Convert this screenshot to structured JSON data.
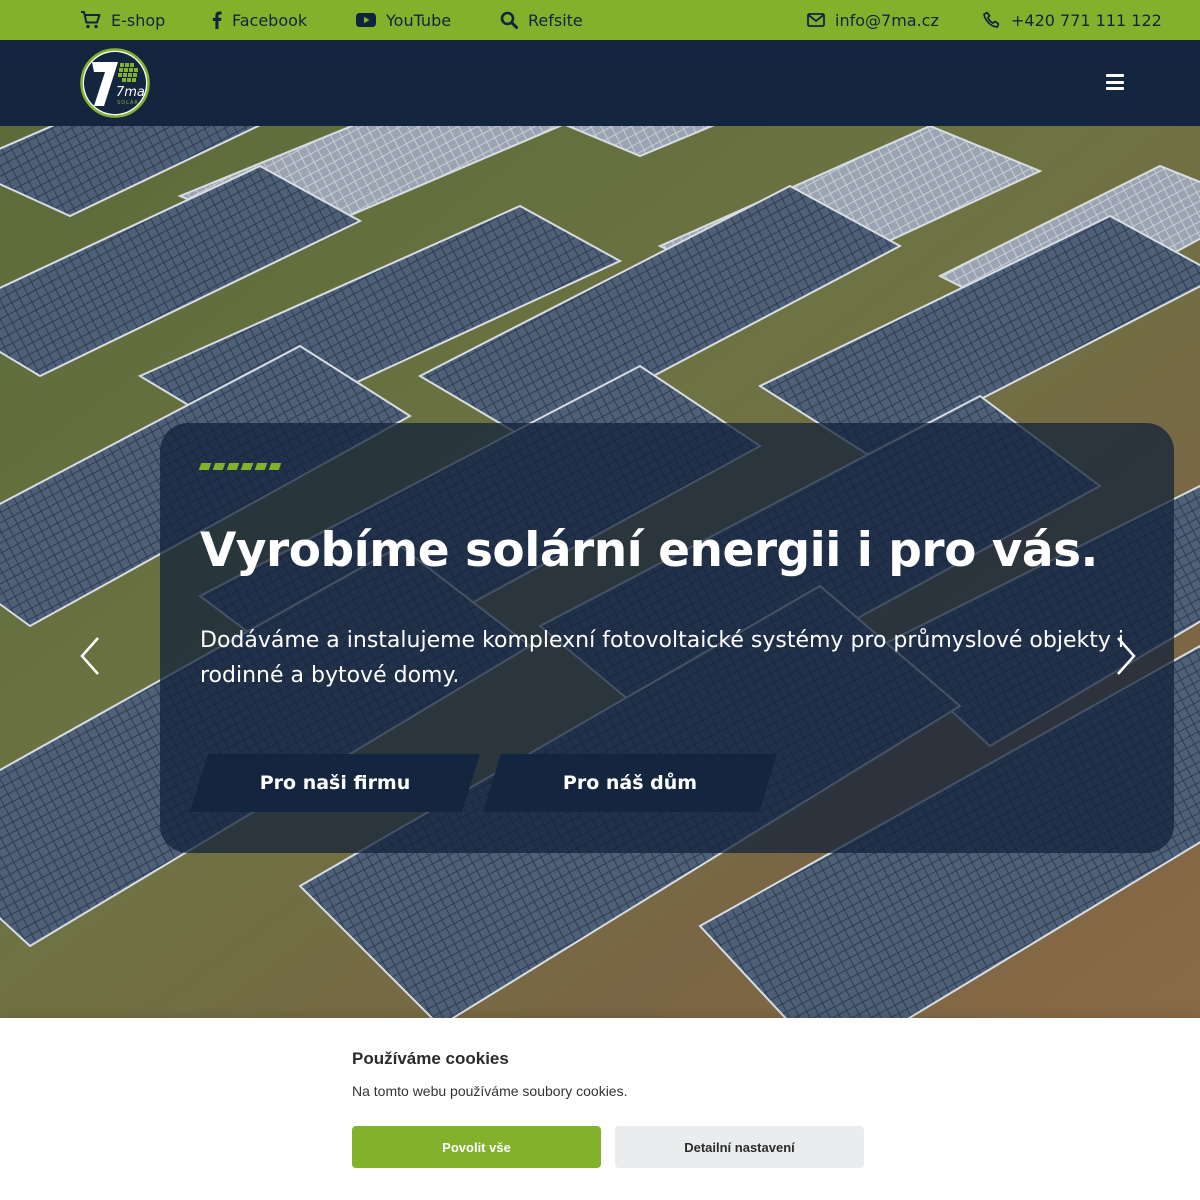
{
  "topbar": {
    "eshop": "E-shop",
    "facebook": "Facebook",
    "youtube": "YouTube",
    "refsite": "Refsite",
    "email": "info@7ma.cz",
    "phone": "+420 771 111 122"
  },
  "header": {
    "logo_text": "7ma",
    "logo_subtext": "SOLAR",
    "menu_icon": "hamburger-menu-icon"
  },
  "hero": {
    "title": "Vyrobíme solární energii i pro vás.",
    "text": "Dodáváme a instalujeme komplexní fotovoltaické systémy pro průmyslové objekty i rodinné a bytové domy.",
    "button_company": "Pro naši firmu",
    "button_home": "Pro náš dům",
    "prev_icon": "chevron-left-icon",
    "next_icon": "chevron-right-icon"
  },
  "cookies": {
    "title": "Používáme cookies",
    "text": "Na tomto webu používáme soubory cookies.",
    "accept_label": "Povolit vše",
    "settings_label": "Detailní nastavení"
  },
  "colors": {
    "accent": "#82b22c",
    "navy": "#13253f"
  }
}
